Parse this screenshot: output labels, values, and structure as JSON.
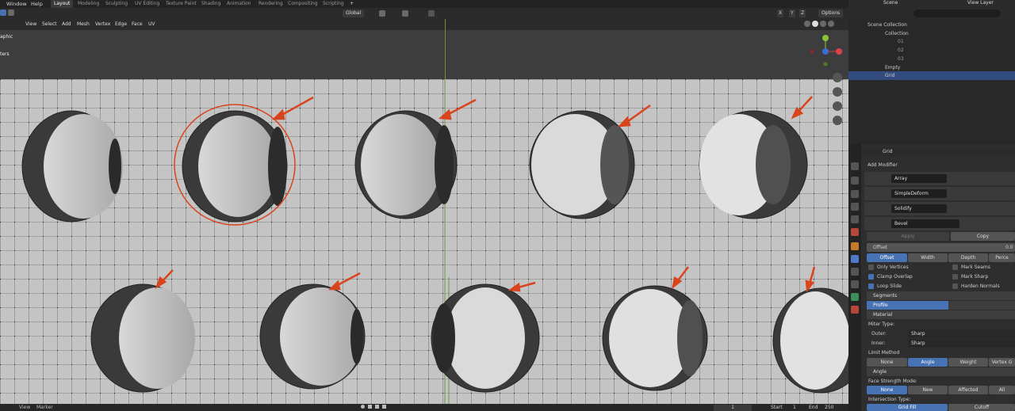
{
  "top_menu": [
    "Window",
    "Help"
  ],
  "workspaces": [
    "Layout",
    "Modeling",
    "Sculpting",
    "UV Editing",
    "Texture Paint",
    "Shading",
    "Animation",
    "Rendering",
    "Compositing",
    "Scripting"
  ],
  "active_workspace": "Layout",
  "add_tab": "+",
  "header": {
    "transform_orientation": "Global",
    "axes": [
      "X",
      "Y",
      "Z"
    ],
    "options": "Options"
  },
  "viewport_menu": [
    "View",
    "Select",
    "Add",
    "Mesh",
    "Vertex",
    "Edge",
    "Face",
    "UV"
  ],
  "viewport_overlay_text": [
    "aphic",
    "ters"
  ],
  "scene": {
    "name": "Scene",
    "view_layer": "View Layer"
  },
  "outliner": {
    "title": "Scene Collection",
    "items": [
      {
        "label": "Collection",
        "depth": 1
      },
      {
        "label": "01",
        "depth": 2
      },
      {
        "label": "02",
        "depth": 2
      },
      {
        "label": "03",
        "depth": 2
      },
      {
        "label": "Empty",
        "depth": 2
      },
      {
        "label": "Grid",
        "depth": 2,
        "selected": true
      }
    ]
  },
  "properties": {
    "object_name": "Grid",
    "add_modifier": "Add Modifier",
    "modifiers": [
      "Array",
      "SimpleDeform",
      "Solidify",
      "Bevel"
    ],
    "apply": "Apply",
    "copy": "Copy",
    "offset_label": "Offset",
    "offset_value": "0.0",
    "width_types": [
      "Offset",
      "Width",
      "Depth",
      "Perce"
    ],
    "active_width_type": "Offset",
    "checkboxes": [
      {
        "label": "Only Vertices",
        "checked": false
      },
      {
        "label": "Mark Seams",
        "checked": false
      },
      {
        "label": "Clamp Overlap",
        "checked": true
      },
      {
        "label": "Mark Sharp",
        "checked": false
      },
      {
        "label": "Loop Slide",
        "checked": true
      },
      {
        "label": "Harden Normals",
        "checked": false
      }
    ],
    "segments": "Segments",
    "profile": "Profile",
    "material": "Material",
    "miter_type": "Miter Type:",
    "outer_label": "Outer:",
    "outer_value": "Sharp",
    "inner_label": "Inner:",
    "inner_value": "Sharp",
    "limit_method": "Limit Method",
    "limit_options": [
      "None",
      "Angle",
      "Weight",
      "Vertex G"
    ],
    "active_limit": "Angle",
    "angle": "Angle",
    "face_strength": "Face Strength Mode:",
    "face_options": [
      "None",
      "New",
      "Affected",
      "All"
    ],
    "active_face": "None",
    "intersection_type": "Intersection Type:",
    "intersection_options": [
      "Grid Fill",
      "Cutoff"
    ],
    "active_intersection": "Grid Fill"
  },
  "timeline": {
    "view": "View",
    "marker": "Marker",
    "frame": "1",
    "start_label": "Start",
    "start": "1",
    "end_label": "End",
    "end": "250"
  },
  "colors": {
    "accent": "#4772b3",
    "annotation": "#d9441c",
    "viewport": "#c2c2c2"
  }
}
